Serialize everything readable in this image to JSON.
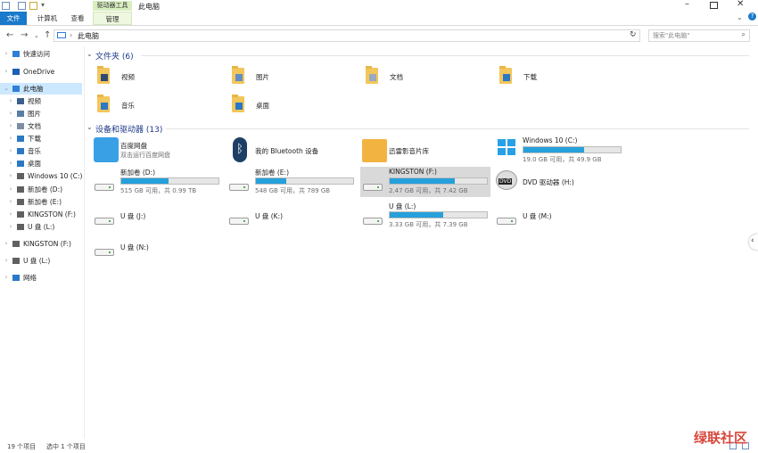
{
  "titlebar": {
    "window_title": "此电脑",
    "context_group": "驱动器工具",
    "help": "?"
  },
  "ribbon": {
    "tabs": [
      "文件",
      "计算机",
      "查看",
      "管理"
    ]
  },
  "address": {
    "path": "此电脑",
    "search_placeholder": "搜索\"此电脑\""
  },
  "nav": {
    "items": [
      {
        "label": "快速访问",
        "icon": "star-icon",
        "color": "#2f7ed8"
      },
      {
        "label": "OneDrive",
        "icon": "cloud-icon",
        "color": "#1e5fb4"
      },
      {
        "label": "此电脑",
        "icon": "computer-icon",
        "color": "#2f7ed8"
      },
      {
        "label": "视频",
        "icon": "video-folder-icon",
        "color": "#3b5f8a"
      },
      {
        "label": "图片",
        "icon": "pictures-folder-icon",
        "color": "#5a7ea6"
      },
      {
        "label": "文档",
        "icon": "documents-folder-icon",
        "color": "#7d8ea3"
      },
      {
        "label": "下载",
        "icon": "downloads-folder-icon",
        "color": "#2a78c6"
      },
      {
        "label": "音乐",
        "icon": "music-folder-icon",
        "color": "#2a78c6"
      },
      {
        "label": "桌面",
        "icon": "desktop-folder-icon",
        "color": "#2a78c6"
      },
      {
        "label": "Windows 10 (C:)",
        "icon": "os-drive-icon",
        "color": "#606060"
      },
      {
        "label": "新加卷 (D:)",
        "icon": "drive-icon",
        "color": "#606060"
      },
      {
        "label": "新加卷 (E:)",
        "icon": "drive-icon",
        "color": "#606060"
      },
      {
        "label": "KINGSTON (F:)",
        "icon": "usb-drive-icon",
        "color": "#606060"
      },
      {
        "label": "U 盘 (L:)",
        "icon": "usb-drive-icon",
        "color": "#606060"
      },
      {
        "label": "KINGSTON (F:)",
        "icon": "usb-drive-icon",
        "color": "#606060"
      },
      {
        "label": "U 盘 (L:)",
        "icon": "usb-drive-icon",
        "color": "#606060"
      },
      {
        "label": "网络",
        "icon": "network-icon",
        "color": "#2a78c6"
      }
    ]
  },
  "folders": {
    "header": "文件夹 (6)",
    "items": [
      "视频",
      "图片",
      "文档",
      "下载",
      "音乐",
      "桌面"
    ]
  },
  "devices": {
    "header": "设备和驱动器 (13)",
    "items": [
      {
        "name": "百度网盘",
        "sub": "双击运行百度网盘",
        "icon": "baidu-netdisk-icon"
      },
      {
        "name": "我的 Bluetooth 设备",
        "sub": "",
        "icon": "bluetooth-icon"
      },
      {
        "name": "迅雷影音片库",
        "sub": "",
        "icon": "xunlei-library-icon"
      },
      {
        "name": "Windows 10 (C:)",
        "sub": "19.0 GB 可用，共 49.9 GB",
        "icon": "os-drive-icon",
        "used_fraction": 0.62
      },
      {
        "name": "新加卷 (D:)",
        "sub": "515 GB 可用，共 0.99 TB",
        "icon": "drive-icon",
        "used_fraction": 0.49
      },
      {
        "name": "新加卷 (E:)",
        "sub": "548 GB 可用，共 789 GB",
        "icon": "drive-icon",
        "used_fraction": 0.31
      },
      {
        "name": "KINGSTON (F:)",
        "sub": "2.47 GB 可用，共 7.42 GB",
        "icon": "usb-drive-icon",
        "used_fraction": 0.67
      },
      {
        "name": "DVD 驱动器 (H:)",
        "sub": "",
        "icon": "dvd-drive-icon"
      },
      {
        "name": "U 盘 (J:)",
        "sub": "",
        "icon": "usb-drive-icon"
      },
      {
        "name": "U 盘 (K:)",
        "sub": "",
        "icon": "usb-drive-icon"
      },
      {
        "name": "U 盘 (L:)",
        "sub": "3.33 GB 可用，共 7.39 GB",
        "icon": "usb-drive-icon",
        "used_fraction": 0.55
      },
      {
        "name": "U 盘 (M:)",
        "sub": "",
        "icon": "usb-drive-icon"
      },
      {
        "name": "U 盘 (N:)",
        "sub": "",
        "icon": "usb-drive-icon"
      }
    ]
  },
  "status": {
    "count": "19 个项目",
    "selected": "选中 1 个项目"
  },
  "watermark": "绿联社区",
  "colors": {
    "accent": "#1979ca",
    "capacity_fill": "#26a0da",
    "selection": "#cce8ff",
    "context_tab": "#d8eec0"
  }
}
